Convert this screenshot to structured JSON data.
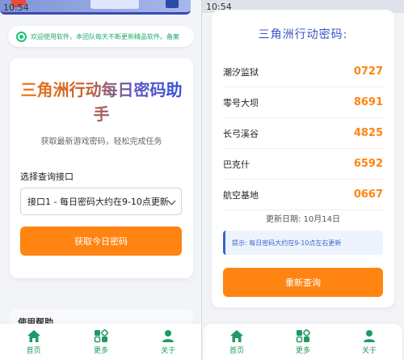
{
  "colors": {
    "accent": "#ff8412",
    "green": "#1e9a62",
    "blue": "#3a54c8"
  },
  "left": {
    "status_time": "10:54",
    "notice": "欢迎使用软件，本团队每天不断更新精品软件。备案",
    "title": "三角洲行动每日密码助手",
    "subtitle": "获取最新游戏密码，轻松完成任务",
    "select_label": "选择查询接口",
    "select_value": "接口1 - 每日密码大约在9-10点更新",
    "primary_button": "获取今日密码",
    "help_title": "使用帮助"
  },
  "right": {
    "status_time": "10:54",
    "title": "三角洲行动密码:",
    "rows": [
      {
        "name": "潮汐监狱",
        "code": "0727"
      },
      {
        "name": "零号大坝",
        "code": "8691"
      },
      {
        "name": "长弓溪谷",
        "code": "4825"
      },
      {
        "name": "巴克什",
        "code": "6592"
      },
      {
        "name": "航空基地",
        "code": "0667"
      }
    ],
    "update_date": "更新日期: 10月14日",
    "tip": "提示: 每日密码大约在9-10点左右更新",
    "refresh_button": "重新查询"
  },
  "nav": [
    {
      "label": "首页",
      "icon": "home-icon"
    },
    {
      "label": "更多",
      "icon": "more-icon"
    },
    {
      "label": "关于",
      "icon": "about-icon"
    }
  ]
}
